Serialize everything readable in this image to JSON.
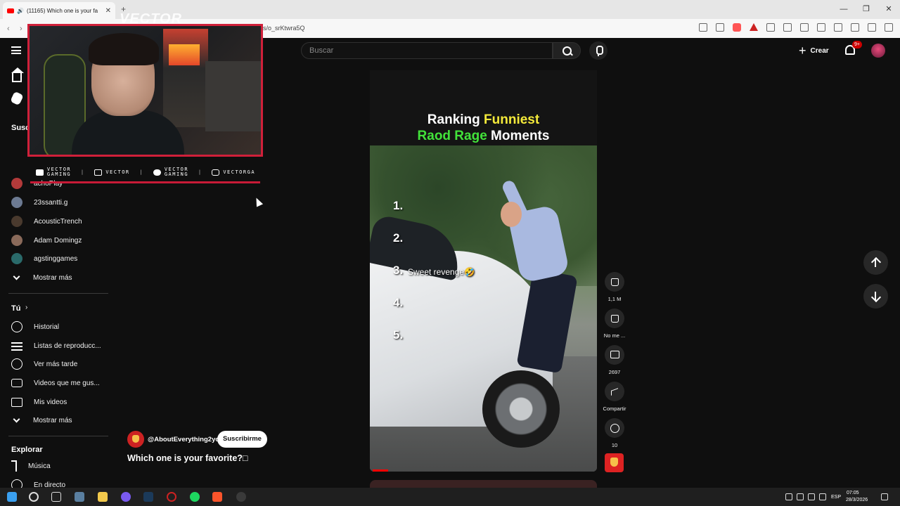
{
  "browser": {
    "tab_title": "(11165) Which one is your fa",
    "url_fragment": "s/o_srKtwra5Q",
    "window_controls": [
      "—",
      "❐",
      "✕"
    ]
  },
  "youtube": {
    "search_placeholder": "Buscar",
    "create_label": "Crear",
    "notification_count": "9+"
  },
  "overlay": {
    "brand_text": "VECTOR",
    "socials": [
      {
        "label": "VECTOR\nGAMING",
        "icon": "youtube-icon"
      },
      {
        "label": "VECTOR",
        "icon": "twitch-icon"
      },
      {
        "label": "VECTOR\nGAMING",
        "icon": "twitter-icon"
      },
      {
        "label": "VECTORGA",
        "icon": "instagram-icon"
      }
    ]
  },
  "sidebar": {
    "subs_heading": "Susc",
    "channels": [
      {
        "name": "23ssantti.g",
        "color": "#6c7a92"
      },
      {
        "name": "AcousticTrench",
        "color": "#4a3a2e"
      },
      {
        "name": "Adam Domingz",
        "color": "#8a6a5a"
      },
      {
        "name": "agstinggames",
        "color": "#2a6a6a"
      }
    ],
    "partial_channel": "achoPlay",
    "show_more_1": "Mostrar más",
    "you_heading": "Tú",
    "you_items": [
      "Historial",
      "Listas de reproducc...",
      "Ver más tarde",
      "Videos que me gus...",
      "Mis videos"
    ],
    "show_more_2": "Mostrar más",
    "explore_heading": "Explorar",
    "explore_items": [
      "Música",
      "En directo"
    ]
  },
  "short": {
    "title_line1_white": "Ranking ",
    "title_line1_yellow": "Funniest",
    "title_line2_green": "Raod Rage",
    "title_line2_white": " Moments",
    "ranks": [
      "1.",
      "2.",
      "3.",
      "4.",
      "5."
    ],
    "caption": "Sweet revenge🤣",
    "progress_fraction": 0.07,
    "channel": "@AboutEverything2yo",
    "subscribe_label": "Suscribirme",
    "description": "Which one is your favorite?□"
  },
  "actions": {
    "like_count": "1,1 M",
    "dislike_label": "No me ...",
    "comments_count": "2697",
    "share_label": "Compartir",
    "remix_count": "10"
  },
  "taskbar": {
    "language": "ESP",
    "time": "07:05",
    "date": "28/3/2026"
  }
}
